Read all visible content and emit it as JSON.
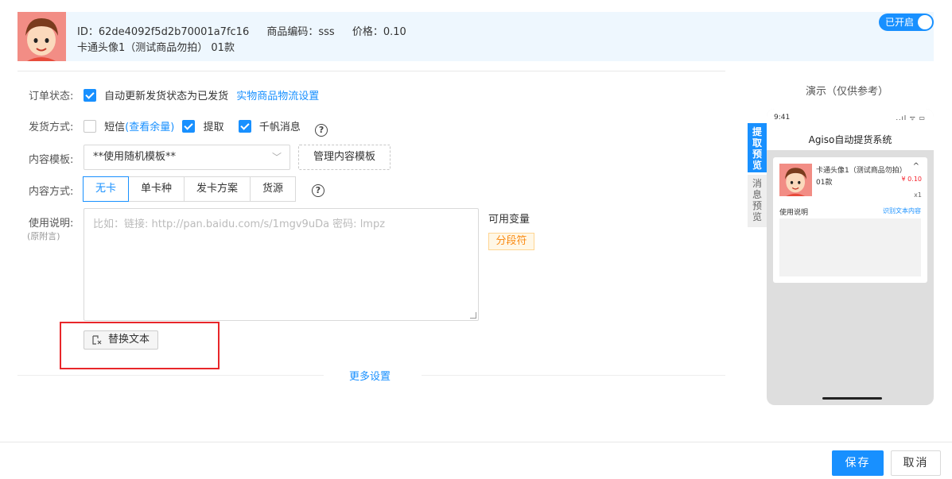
{
  "product": {
    "id_label": "ID：",
    "id_value": "62de4092f5d2b70001a7fc16",
    "code_label": "商品编码：",
    "code_value": "sss",
    "price_label": "价格：",
    "price_value": "0.10",
    "name": "卡通头像1（测试商品勿拍） 01款",
    "toggle_label": "已开启"
  },
  "form": {
    "order_status": {
      "label": "订单状态:",
      "checkbox_label": "自动更新发货状态为已发货",
      "link": "实物商品物流设置"
    },
    "delivery": {
      "label": "发货方式:",
      "sms_label": "短信",
      "sms_link": "(查看余量)",
      "pickup_label": "提取",
      "qianfan_label": "千帆消息",
      "help": "?"
    },
    "template": {
      "label": "内容模板:",
      "selected": "**使用随机模板**",
      "chevron": "﹀",
      "manage_button": "管理内容模板"
    },
    "content_mode": {
      "label": "内容方式:",
      "options": [
        "无卡",
        "单卡种",
        "发卡方案",
        "货源"
      ],
      "selected": "无卡",
      "help": "?"
    },
    "usage": {
      "label": "使用说明:",
      "sublabel": "(原附言)",
      "placeholder": "比如：链接: http://pan.baidu.com/s/1mgv9uDa 密码: lmpz",
      "vars_title": "可用变量",
      "var_tag": "分段符",
      "replace_button": "替换文本"
    },
    "more_settings": "更多设置"
  },
  "preview": {
    "title": "演示（仅供参考）",
    "tab_active": [
      "提",
      "取",
      "预",
      "览"
    ],
    "tab_inactive": [
      "消",
      "息",
      "预",
      "览"
    ],
    "phone": {
      "time": "9:41",
      "status": "..ıl ᯤ ▭",
      "app_title": "Agiso自动提货系统",
      "item_name": "卡通头像1（测试商品勿拍）01款",
      "caret": "^",
      "price": "¥ 0.10",
      "qty": "x1",
      "usage_label": "使用说明",
      "recognize_link": "识别文本内容"
    }
  },
  "footer": {
    "save": "保存",
    "cancel": "取消"
  },
  "colors": {
    "primary": "#1890ff",
    "header_bg": "#eef7fe",
    "highlight_red": "#e8262a",
    "tag_orange": "#fa8c16"
  }
}
